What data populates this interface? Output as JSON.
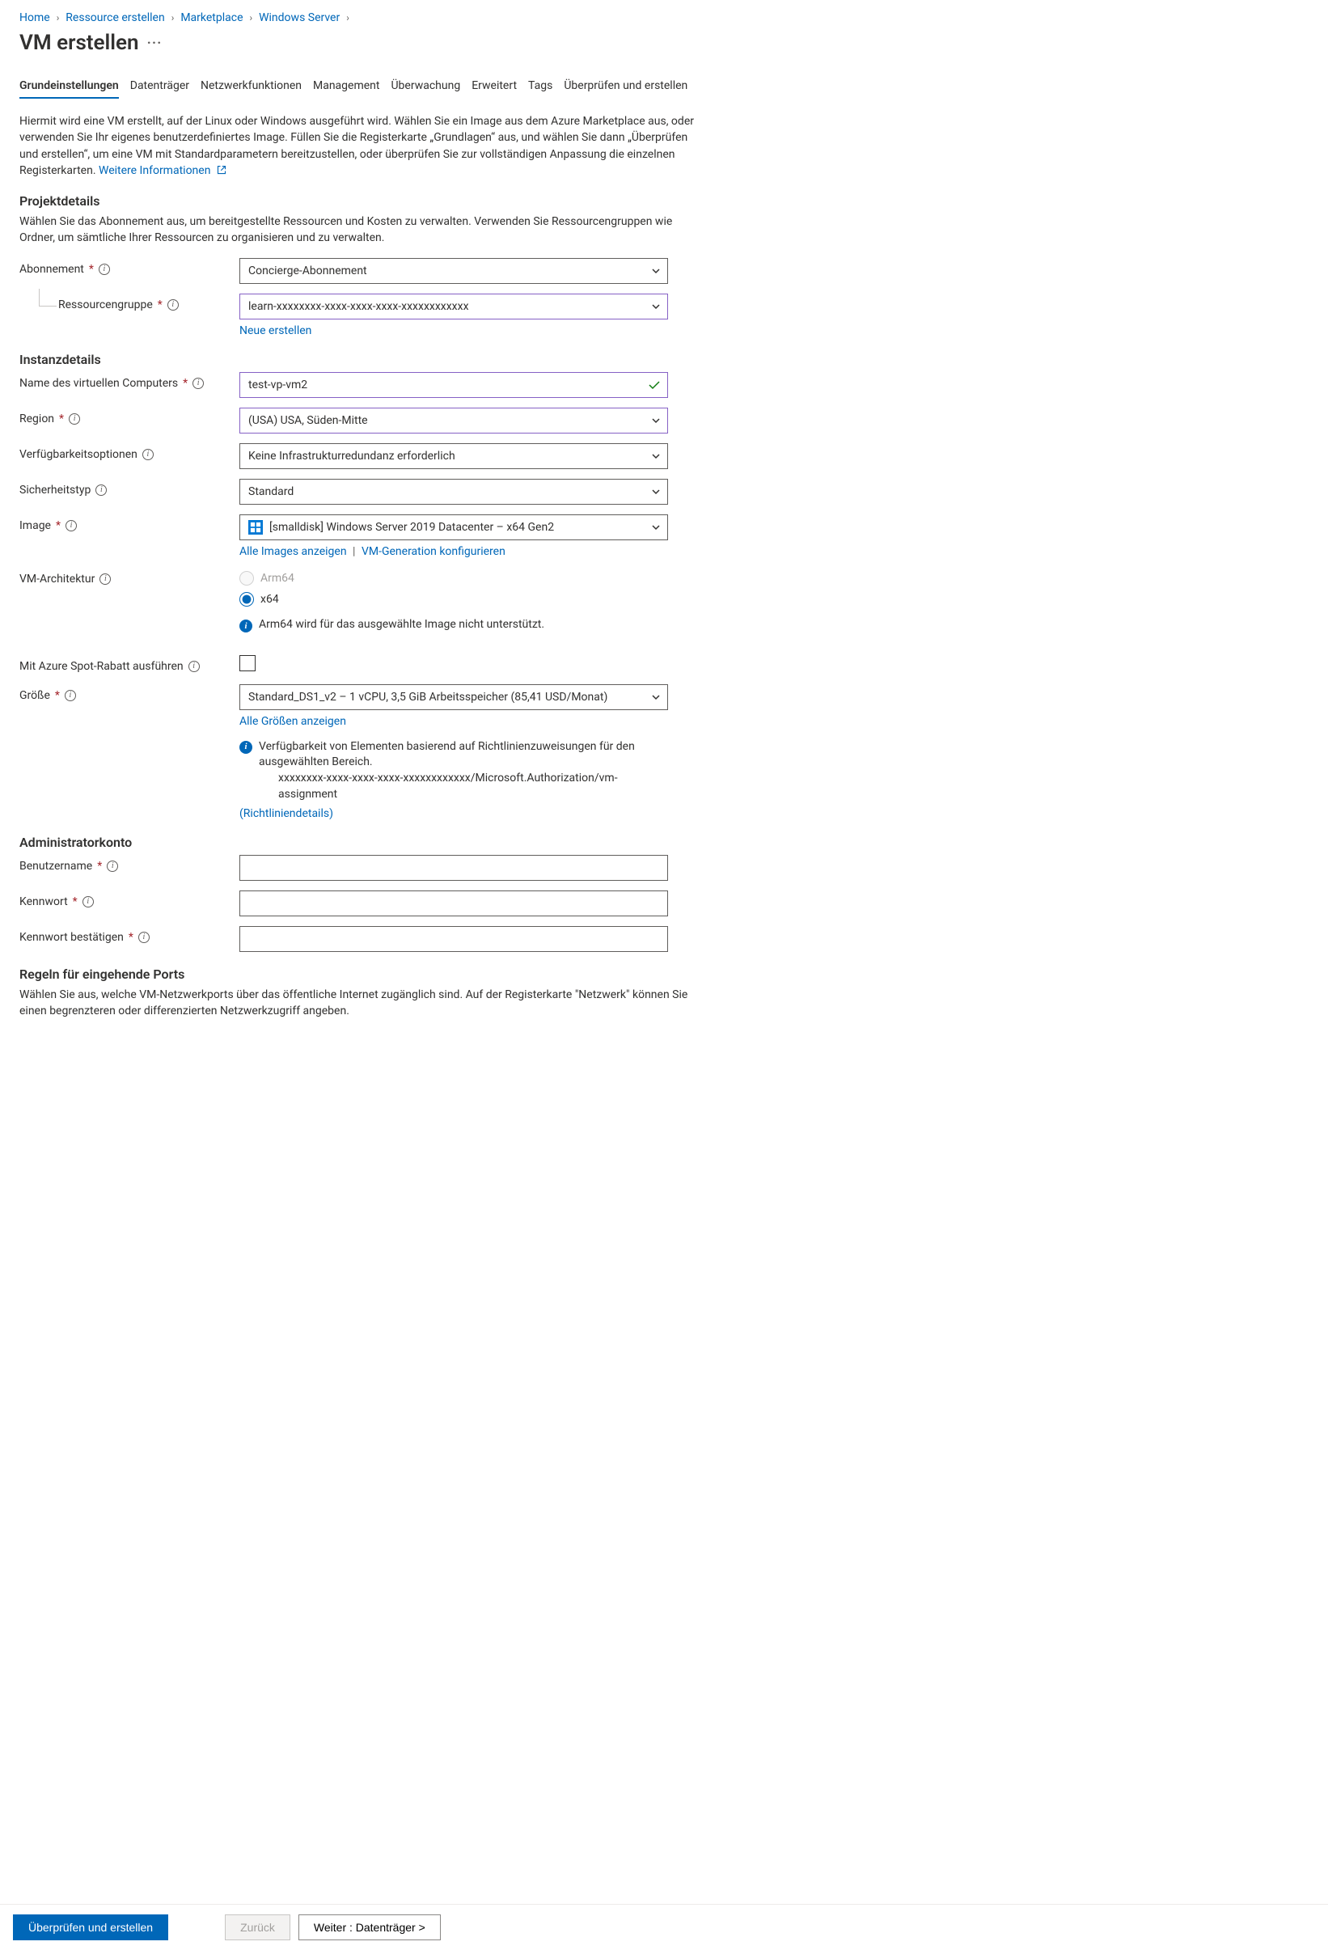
{
  "breadcrumbs": {
    "home": "Home",
    "create_resource": "Ressource erstellen",
    "marketplace": "Marketplace",
    "product": "Windows Server"
  },
  "page_title": "VM erstellen",
  "tabs": {
    "basics": "Grundeinstellungen",
    "disks": "Datenträger",
    "networking": "Netzwerkfunktionen",
    "management": "Management",
    "monitoring": "Überwachung",
    "advanced": "Erweitert",
    "tags": "Tags",
    "review": "Überprüfen und erstellen"
  },
  "intro": {
    "text": "Hiermit wird eine VM erstellt, auf der Linux oder Windows ausgeführt wird. Wählen Sie ein Image aus dem Azure Marketplace aus, oder verwenden Sie Ihr eigenes benutzerdefiniertes Image. Füllen Sie die Registerkarte „Grundlagen“ aus, und wählen Sie dann „Überprüfen und erstellen“, um eine VM mit Standardparametern bereitzustellen, oder überprüfen Sie zur vollständigen Anpassung die einzelnen Registerkarten.",
    "more_info": "Weitere Informationen"
  },
  "project": {
    "heading": "Projektdetails",
    "desc": "Wählen Sie das Abonnement aus, um bereitgestellte Ressourcen und Kosten zu verwalten. Verwenden Sie Ressourcengruppen wie Ordner, um sämtliche Ihrer Ressourcen zu organisieren und zu verwalten.",
    "subscription_label": "Abonnement",
    "subscription_value": "Concierge-Abonnement",
    "rg_label": "Ressourcengruppe",
    "rg_value": "learn-xxxxxxxx-xxxx-xxxx-xxxx-xxxxxxxxxxxx",
    "rg_new": "Neue erstellen"
  },
  "instance": {
    "heading": "Instanzdetails",
    "name_label": "Name des virtuellen Computers",
    "name_value": "test-vp-vm2",
    "region_label": "Region",
    "region_value": "(USA) USA, Süden-Mitte",
    "avail_label": "Verfügbarkeitsoptionen",
    "avail_value": "Keine Infrastrukturredundanz erforderlich",
    "sectype_label": "Sicherheitstyp",
    "sectype_value": "Standard",
    "image_label": "Image",
    "image_value": "[smalldisk] Windows Server 2019 Datacenter – x64 Gen2",
    "image_all": "Alle Images anzeigen",
    "image_gen": "VM-Generation konfigurieren",
    "arch_label": "VM-Architektur",
    "arch_arm": "Arm64",
    "arch_x64": "x64",
    "arch_note": "Arm64 wird für das ausgewählte Image nicht unterstützt.",
    "spot_label": "Mit Azure Spot-Rabatt ausführen",
    "size_label": "Größe",
    "size_value": "Standard_DS1_v2 – 1 vCPU, 3,5 GiB Arbeitsspeicher (85,41 USD/Monat)",
    "size_all": "Alle Größen anzeigen",
    "size_policy_line1": "Verfügbarkeit von Elementen basierend auf Richtlinienzuweisungen für den ausgewählten Bereich.",
    "size_policy_line2": "xxxxxxxx-xxxx-xxxx-xxxx-xxxxxxxxxxxx/Microsoft.Authorization/vm-assignment",
    "size_policy_link": "(Richtliniendetails)"
  },
  "admin": {
    "heading": "Administratorkonto",
    "user_label": "Benutzername",
    "pw_label": "Kennwort",
    "pwc_label": "Kennwort bestätigen"
  },
  "ports": {
    "heading": "Regeln für eingehende Ports",
    "desc": "Wählen Sie aus, welche VM-Netzwerkports über das öffentliche Internet zugänglich sind. Auf der Registerkarte \"Netzwerk\" können Sie einen begrenzteren oder differenzierten Netzwerkzugriff angeben."
  },
  "footer": {
    "review": "Überprüfen und erstellen",
    "back": "Zurück",
    "next": "Weiter : Datenträger >"
  }
}
